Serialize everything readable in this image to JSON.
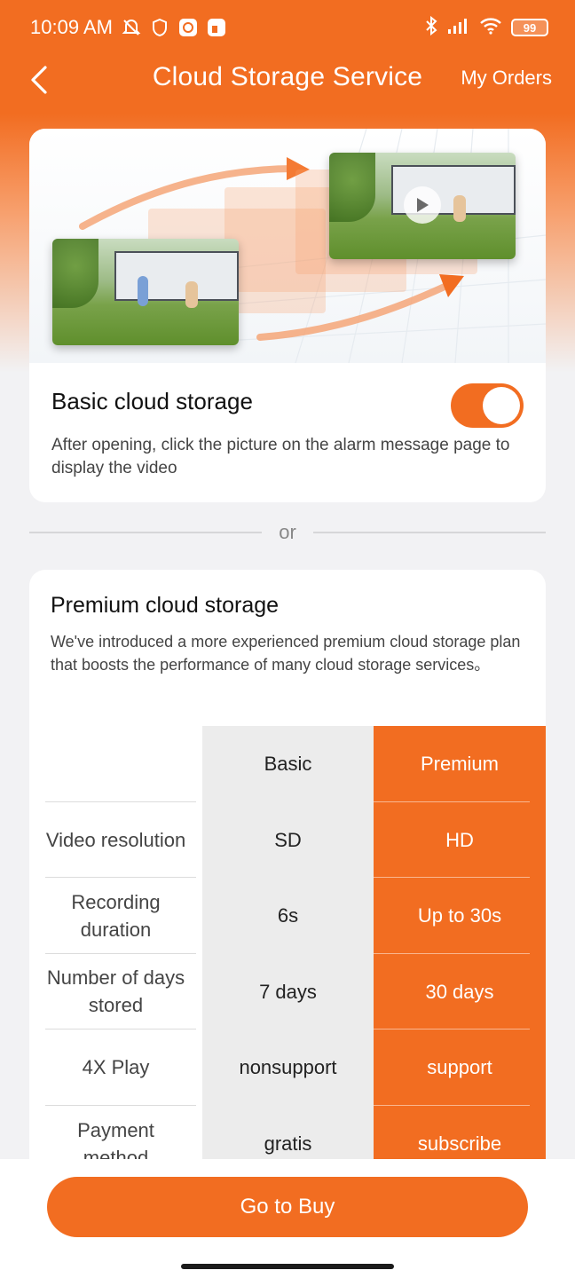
{
  "status_bar": {
    "time": "10:09 AM",
    "battery": "99",
    "icons": [
      "mute-icon",
      "shield-icon",
      "location-icon",
      "app-icon",
      "bluetooth-icon",
      "signal-icon",
      "wifi-icon",
      "battery-icon"
    ]
  },
  "header": {
    "title": "Cloud Storage Service",
    "my_orders": "My Orders",
    "back_icon": "chevron-left-icon"
  },
  "basic": {
    "title": "Basic cloud storage",
    "description": "After opening, click the picture on the alarm message page to display the video",
    "toggle_on": true
  },
  "divider": {
    "or": "or"
  },
  "premium": {
    "title": "Premium cloud storage",
    "description": "We've introduced a more experienced premium cloud storage plan that boosts the performance of many cloud storage services。",
    "table": {
      "header": {
        "label": "",
        "basic": "Basic",
        "premium": "Premium"
      },
      "rows": [
        {
          "label": "Video resolution",
          "basic": "SD",
          "premium": "HD"
        },
        {
          "label": "Recording duration",
          "basic": "6s",
          "premium": "Up to 30s"
        },
        {
          "label": "Number of days stored",
          "basic": "7 days",
          "premium": "30 days"
        },
        {
          "label": "4X Play",
          "basic": "nonsupport",
          "premium": "support"
        },
        {
          "label": "Payment method",
          "basic": "gratis",
          "premium": "subscribe"
        }
      ]
    }
  },
  "footer": {
    "buy_label": "Go to Buy"
  },
  "colors": {
    "accent": "#f26d21",
    "background": "#f2f2f4"
  }
}
